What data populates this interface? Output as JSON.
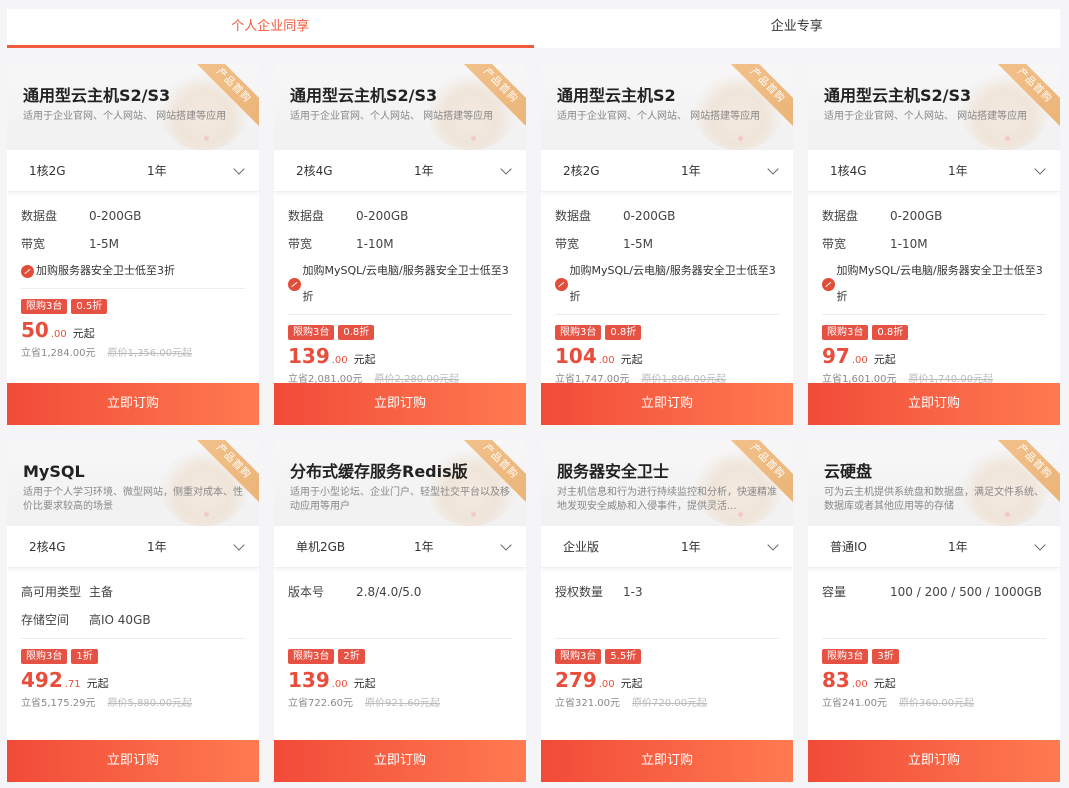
{
  "tabs": [
    {
      "label": "个人企业同享",
      "active": true
    },
    {
      "label": "企业专享",
      "active": false
    }
  ],
  "ribbon_label": "产品首购",
  "buy_label": "立即订购",
  "price_unit": "元起",
  "cards": [
    {
      "title": "通用型云主机S2/S3",
      "desc": "适用于企业官网、个人网站、 网站搭建等应用",
      "spec": "1核2G",
      "period": "1年",
      "specs": [
        {
          "k": "数据盘",
          "v": "0-200GB"
        },
        {
          "k": "带宽",
          "v": "1-5M"
        }
      ],
      "promo": "加购服务器安全卫士低至3折",
      "tags": [
        "限购3台",
        "0.5折"
      ],
      "price_int": "50",
      "price_dec": ".00",
      "save": "立省1,284.00元",
      "orig": "原价1,356.00元起"
    },
    {
      "title": "通用型云主机S2/S3",
      "desc": "适用于企业官网、个人网站、 网站搭建等应用",
      "spec": "2核4G",
      "period": "1年",
      "specs": [
        {
          "k": "数据盘",
          "v": "0-200GB"
        },
        {
          "k": "带宽",
          "v": "1-10M"
        }
      ],
      "promo": "加购MySQL/云电脑/服务器安全卫士低至3折",
      "tags": [
        "限购3台",
        "0.8折"
      ],
      "price_int": "139",
      "price_dec": ".00",
      "save": "立省2,081.00元",
      "orig": "原价2,280.00元起"
    },
    {
      "title": "通用型云主机S2",
      "desc": "适用于企业官网、个人网站、 网站搭建等应用",
      "spec": "2核2G",
      "period": "1年",
      "specs": [
        {
          "k": "数据盘",
          "v": "0-200GB"
        },
        {
          "k": "带宽",
          "v": "1-5M"
        }
      ],
      "promo": "加购MySQL/云电脑/服务器安全卫士低至3折",
      "tags": [
        "限购3台",
        "0.8折"
      ],
      "price_int": "104",
      "price_dec": ".00",
      "save": "立省1,747.00元",
      "orig": "原价1,896.00元起"
    },
    {
      "title": "通用型云主机S2/S3",
      "desc": "适用于企业官网、个人网站、 网站搭建等应用",
      "spec": "1核4G",
      "period": "1年",
      "specs": [
        {
          "k": "数据盘",
          "v": "0-200GB"
        },
        {
          "k": "带宽",
          "v": "1-10M"
        }
      ],
      "promo": "加购MySQL/云电脑/服务器安全卫士低至3折",
      "tags": [
        "限购3台",
        "0.8折"
      ],
      "price_int": "97",
      "price_dec": ".00",
      "save": "立省1,601.00元",
      "orig": "原价1,740.00元起"
    },
    {
      "title": "MySQL",
      "desc": "适用于个人学习环境、微型网站，侧重对成本、性价比要求较高的场景",
      "spec": "2核4G",
      "period": "1年",
      "specs": [
        {
          "k": "高可用类型",
          "v": "主备"
        },
        {
          "k": "存储空间",
          "v": "高IO 40GB"
        }
      ],
      "promo": "",
      "tags": [
        "限购3台",
        "1折"
      ],
      "price_int": "492",
      "price_dec": ".71",
      "save": "立省5,175.29元",
      "orig": "原价5,880.00元起"
    },
    {
      "title": "分布式缓存服务Redis版",
      "desc": "适用于小型论坛、企业门户、轻型社交平台以及移动应用等用户",
      "spec": "单机2GB",
      "period": "1年",
      "specs": [
        {
          "k": "版本号",
          "v": "2.8/4.0/5.0"
        }
      ],
      "promo": "",
      "tags": [
        "限购3台",
        "2折"
      ],
      "price_int": "139",
      "price_dec": ".00",
      "save": "立省722.60元",
      "orig": "原价921.60元起"
    },
    {
      "title": "服务器安全卫士",
      "desc": "对主机信息和行为进行持续监控和分析，快速精准地发现安全威胁和入侵事件，提供灵活...",
      "spec": "企业版",
      "period": "1年",
      "specs": [
        {
          "k": "授权数量",
          "v": "1-3"
        }
      ],
      "promo": "",
      "tags": [
        "限购3台",
        "5.5折"
      ],
      "price_int": "279",
      "price_dec": ".00",
      "save": "立省321.00元",
      "orig": "原价720.00元起"
    },
    {
      "title": "云硬盘",
      "desc": "可为云主机提供系统盘和数据盘，满足文件系统、数据库或者其他应用等的存储",
      "spec": "普通IO",
      "period": "1年",
      "specs": [
        {
          "k": "容量",
          "v": "100 / 200 / 500 / 1000GB"
        }
      ],
      "promo": "",
      "tags": [
        "限购3台",
        "3折"
      ],
      "price_int": "83",
      "price_dec": ".00",
      "save": "立省241.00元",
      "orig": "原价360.00元起"
    }
  ]
}
